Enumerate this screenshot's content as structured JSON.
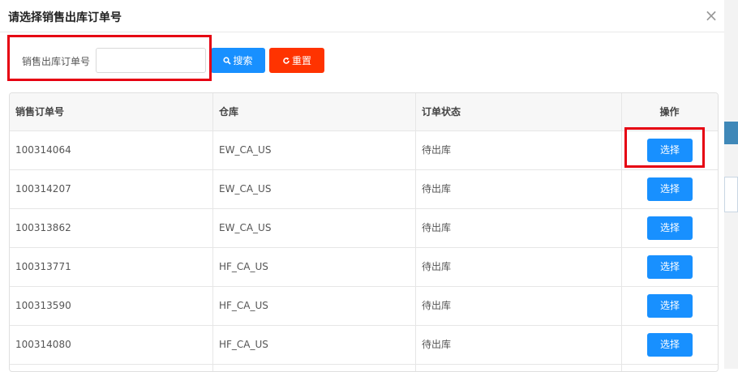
{
  "dialog": {
    "title": "请选择销售出库订单号",
    "close_symbol": "×"
  },
  "search": {
    "label": "销售出库订单号",
    "input_value": "",
    "search_label": "搜索",
    "reset_label": "重置"
  },
  "table": {
    "headers": [
      "销售订单号",
      "仓库",
      "订单状态",
      "操作"
    ],
    "rows": [
      {
        "order_no": "100314064",
        "warehouse": "EW_CA_US",
        "status": "待出库",
        "action": "选择"
      },
      {
        "order_no": "100314207",
        "warehouse": "EW_CA_US",
        "status": "待出库",
        "action": "选择"
      },
      {
        "order_no": "100313862",
        "warehouse": "EW_CA_US",
        "status": "待出库",
        "action": "选择"
      },
      {
        "order_no": "100313771",
        "warehouse": "HF_CA_US",
        "status": "待出库",
        "action": "选择"
      },
      {
        "order_no": "100313590",
        "warehouse": "HF_CA_US",
        "status": "待出库",
        "action": "选择"
      },
      {
        "order_no": "100314080",
        "warehouse": "HF_CA_US",
        "status": "待出库",
        "action": "选择"
      }
    ]
  },
  "colors": {
    "primary": "#1890ff",
    "danger": "#ff3300",
    "highlight": "#e60012"
  },
  "icons": {
    "search": "search-icon",
    "reset": "refresh-icon",
    "close": "close-icon"
  }
}
